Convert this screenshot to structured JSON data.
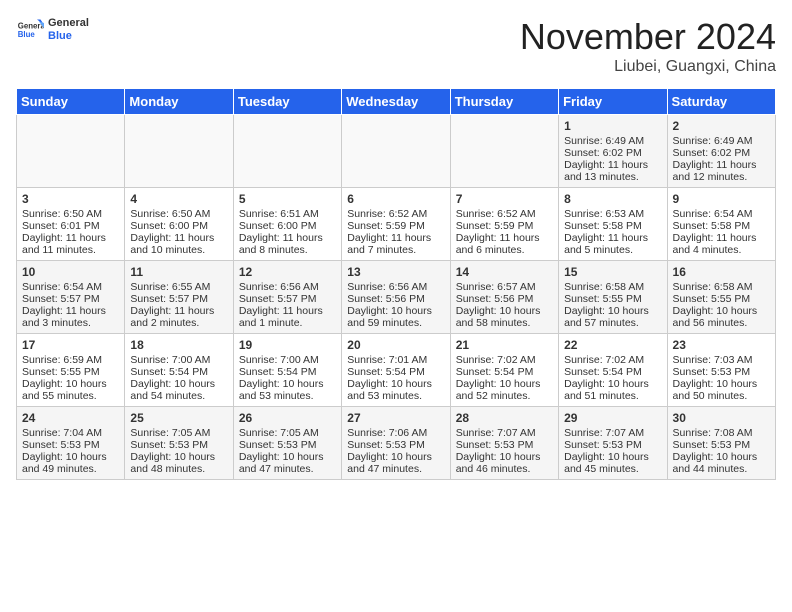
{
  "header": {
    "logo_general": "General",
    "logo_blue": "Blue",
    "month_title": "November 2024",
    "location": "Liubei, Guangxi, China"
  },
  "weekdays": [
    "Sunday",
    "Monday",
    "Tuesday",
    "Wednesday",
    "Thursday",
    "Friday",
    "Saturday"
  ],
  "weeks": [
    [
      {
        "day": "",
        "info": ""
      },
      {
        "day": "",
        "info": ""
      },
      {
        "day": "",
        "info": ""
      },
      {
        "day": "",
        "info": ""
      },
      {
        "day": "",
        "info": ""
      },
      {
        "day": "1",
        "info": "Sunrise: 6:49 AM\nSunset: 6:02 PM\nDaylight: 11 hours and 13 minutes."
      },
      {
        "day": "2",
        "info": "Sunrise: 6:49 AM\nSunset: 6:02 PM\nDaylight: 11 hours and 12 minutes."
      }
    ],
    [
      {
        "day": "3",
        "info": "Sunrise: 6:50 AM\nSunset: 6:01 PM\nDaylight: 11 hours and 11 minutes."
      },
      {
        "day": "4",
        "info": "Sunrise: 6:50 AM\nSunset: 6:00 PM\nDaylight: 11 hours and 10 minutes."
      },
      {
        "day": "5",
        "info": "Sunrise: 6:51 AM\nSunset: 6:00 PM\nDaylight: 11 hours and 8 minutes."
      },
      {
        "day": "6",
        "info": "Sunrise: 6:52 AM\nSunset: 5:59 PM\nDaylight: 11 hours and 7 minutes."
      },
      {
        "day": "7",
        "info": "Sunrise: 6:52 AM\nSunset: 5:59 PM\nDaylight: 11 hours and 6 minutes."
      },
      {
        "day": "8",
        "info": "Sunrise: 6:53 AM\nSunset: 5:58 PM\nDaylight: 11 hours and 5 minutes."
      },
      {
        "day": "9",
        "info": "Sunrise: 6:54 AM\nSunset: 5:58 PM\nDaylight: 11 hours and 4 minutes."
      }
    ],
    [
      {
        "day": "10",
        "info": "Sunrise: 6:54 AM\nSunset: 5:57 PM\nDaylight: 11 hours and 3 minutes."
      },
      {
        "day": "11",
        "info": "Sunrise: 6:55 AM\nSunset: 5:57 PM\nDaylight: 11 hours and 2 minutes."
      },
      {
        "day": "12",
        "info": "Sunrise: 6:56 AM\nSunset: 5:57 PM\nDaylight: 11 hours and 1 minute."
      },
      {
        "day": "13",
        "info": "Sunrise: 6:56 AM\nSunset: 5:56 PM\nDaylight: 10 hours and 59 minutes."
      },
      {
        "day": "14",
        "info": "Sunrise: 6:57 AM\nSunset: 5:56 PM\nDaylight: 10 hours and 58 minutes."
      },
      {
        "day": "15",
        "info": "Sunrise: 6:58 AM\nSunset: 5:55 PM\nDaylight: 10 hours and 57 minutes."
      },
      {
        "day": "16",
        "info": "Sunrise: 6:58 AM\nSunset: 5:55 PM\nDaylight: 10 hours and 56 minutes."
      }
    ],
    [
      {
        "day": "17",
        "info": "Sunrise: 6:59 AM\nSunset: 5:55 PM\nDaylight: 10 hours and 55 minutes."
      },
      {
        "day": "18",
        "info": "Sunrise: 7:00 AM\nSunset: 5:54 PM\nDaylight: 10 hours and 54 minutes."
      },
      {
        "day": "19",
        "info": "Sunrise: 7:00 AM\nSunset: 5:54 PM\nDaylight: 10 hours and 53 minutes."
      },
      {
        "day": "20",
        "info": "Sunrise: 7:01 AM\nSunset: 5:54 PM\nDaylight: 10 hours and 53 minutes."
      },
      {
        "day": "21",
        "info": "Sunrise: 7:02 AM\nSunset: 5:54 PM\nDaylight: 10 hours and 52 minutes."
      },
      {
        "day": "22",
        "info": "Sunrise: 7:02 AM\nSunset: 5:54 PM\nDaylight: 10 hours and 51 minutes."
      },
      {
        "day": "23",
        "info": "Sunrise: 7:03 AM\nSunset: 5:53 PM\nDaylight: 10 hours and 50 minutes."
      }
    ],
    [
      {
        "day": "24",
        "info": "Sunrise: 7:04 AM\nSunset: 5:53 PM\nDaylight: 10 hours and 49 minutes."
      },
      {
        "day": "25",
        "info": "Sunrise: 7:05 AM\nSunset: 5:53 PM\nDaylight: 10 hours and 48 minutes."
      },
      {
        "day": "26",
        "info": "Sunrise: 7:05 AM\nSunset: 5:53 PM\nDaylight: 10 hours and 47 minutes."
      },
      {
        "day": "27",
        "info": "Sunrise: 7:06 AM\nSunset: 5:53 PM\nDaylight: 10 hours and 47 minutes."
      },
      {
        "day": "28",
        "info": "Sunrise: 7:07 AM\nSunset: 5:53 PM\nDaylight: 10 hours and 46 minutes."
      },
      {
        "day": "29",
        "info": "Sunrise: 7:07 AM\nSunset: 5:53 PM\nDaylight: 10 hours and 45 minutes."
      },
      {
        "day": "30",
        "info": "Sunrise: 7:08 AM\nSunset: 5:53 PM\nDaylight: 10 hours and 44 minutes."
      }
    ]
  ]
}
